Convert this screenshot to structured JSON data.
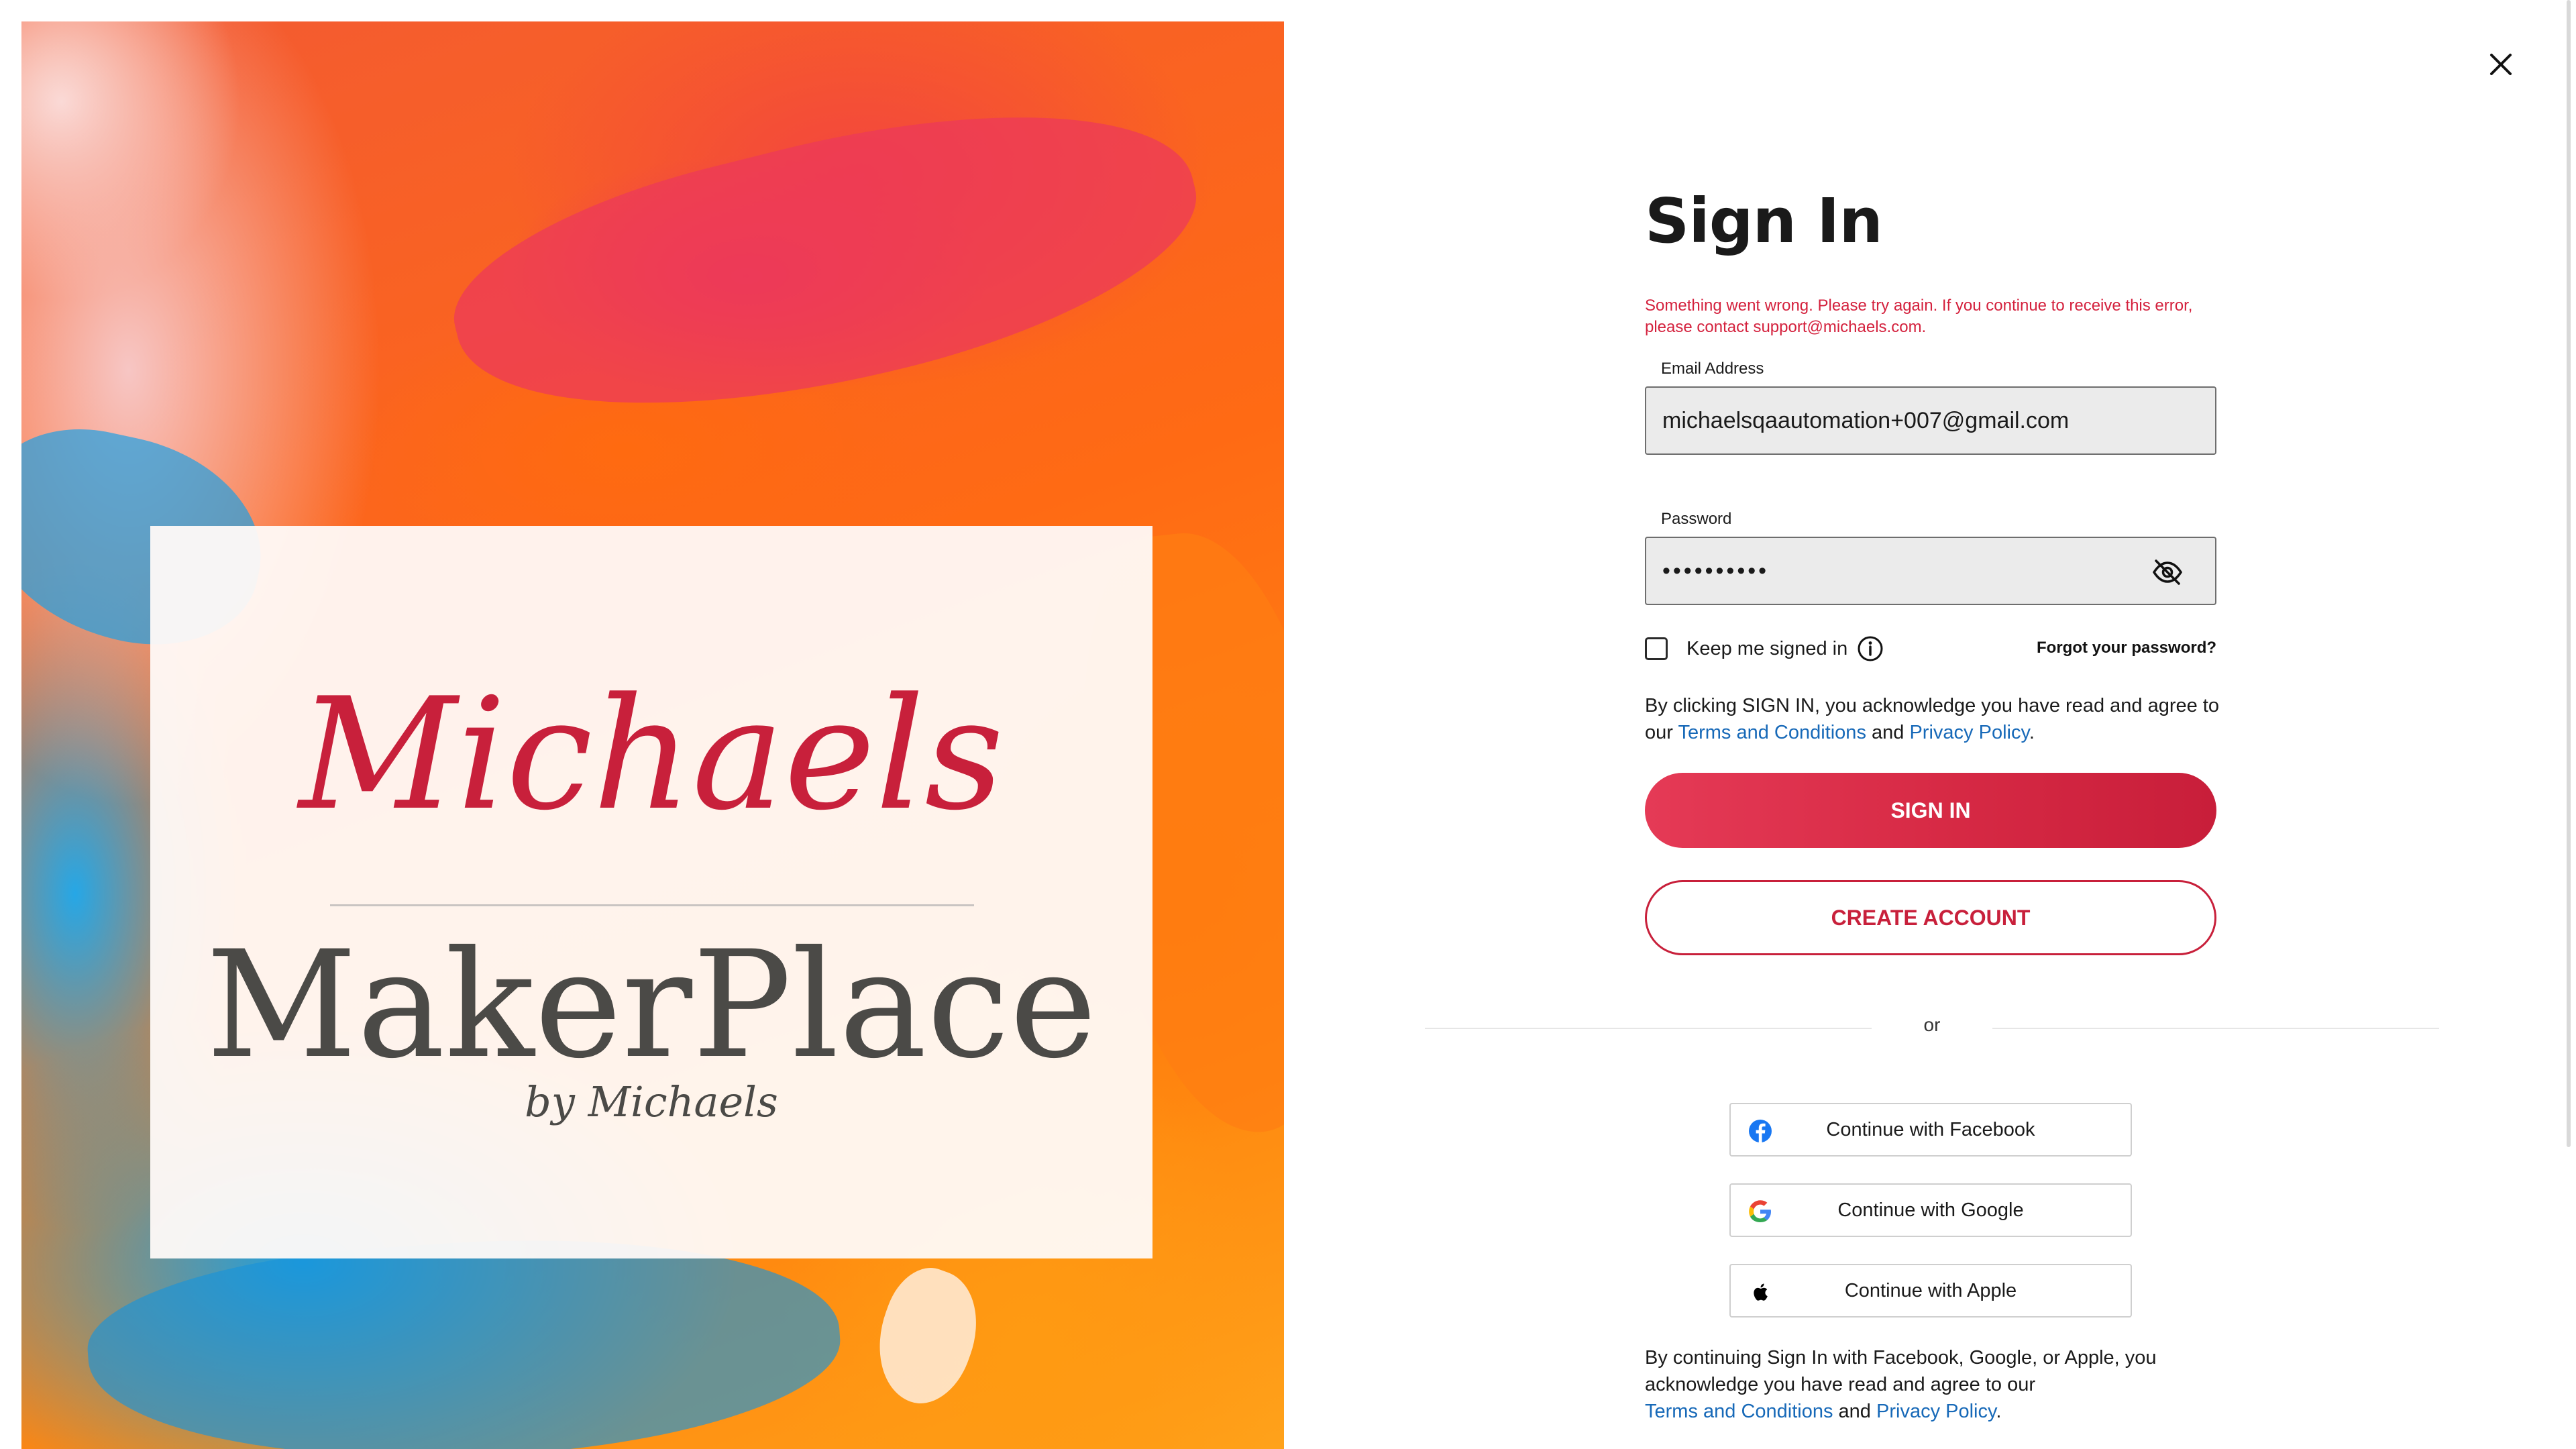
{
  "brand": {
    "michaels_logo": "Michaels",
    "makerplace_logo": "MakerPlace",
    "by_michaels": "by Michaels",
    "brand_red": "#c8203b",
    "makerplace_gray": "#4b4a47",
    "makerplace_blue": "#8ab3d4"
  },
  "dialog": {
    "close_icon": "close-icon",
    "title": "Sign In",
    "error_message": "Something went wrong. Please try again. If you continue to receive this error, please contact support@michaels.com."
  },
  "form": {
    "email_label": "Email Address",
    "email_value": "michaelsqaautomation+007@gmail.com",
    "password_label": "Password",
    "password_value": "••••••••••",
    "password_toggle_icon": "eye-slash-icon",
    "keep_signed_in_label": "Keep me signed in",
    "keep_signed_in_checked": false,
    "info_icon": "info-icon",
    "forgot_password": "Forgot your password?"
  },
  "legal_signin": {
    "prefix": "By clicking SIGN IN, you acknowledge you have read and agree to our",
    "terms": "Terms and Conditions",
    "and": "and",
    "privacy": "Privacy Policy",
    "period": "."
  },
  "buttons": {
    "sign_in": "SIGN IN",
    "create_account": "CREATE ACCOUNT",
    "accent": "#d62944"
  },
  "divider": {
    "or": "or"
  },
  "social": {
    "facebook": "Continue with Facebook",
    "google": "Continue with Google",
    "apple": "Continue with Apple"
  },
  "legal_social": {
    "prefix": "By continuing Sign In with Facebook, Google, or Apple, you acknowledge you have read and agree to our",
    "terms": "Terms and Conditions",
    "and": "and",
    "privacy": "Privacy Policy",
    "period": "."
  },
  "link_color": "#1769b8"
}
